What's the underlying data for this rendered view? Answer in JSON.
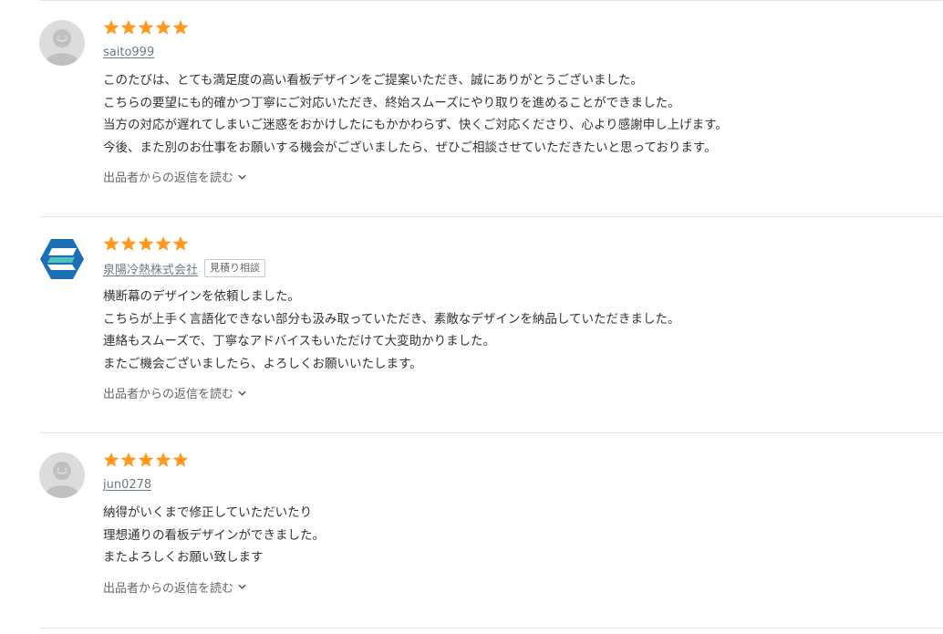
{
  "colors": {
    "star": "#ff9a1f",
    "username": "#6d7a80",
    "divider": "#e5e5e5",
    "text": "#333333",
    "logo_blue": "#1a6fb5",
    "logo_teal": "#4fc3b9"
  },
  "reviews": [
    {
      "rating": 5,
      "avatar": "default-avatar",
      "username": "saito999",
      "tag": "",
      "comment_lines": [
        "このたびは、とても満足度の高い看板デザインをご提案いただき、誠にありがとうございました。",
        "こちらの要望にも的確かつ丁寧にご対応いただき、終始スムーズにやり取りを進めることができました。",
        "当方の対応が遅れてしまいご迷惑をおかけしたにもかかわらず、快くご対応くださり、心より感謝申し上げます。",
        "今後、また別のお仕事をお願いする機会がございましたら、ぜひご相談させていただきたいと思っております。"
      ],
      "reply_label": "出品者からの返信を読む"
    },
    {
      "rating": 5,
      "avatar": "company-logo",
      "username": "泉陽冷熱株式会社",
      "tag": "見積り相談",
      "comment_lines": [
        "横断幕のデザインを依頼しました。",
        "こちらが上手く言語化できない部分も汲み取っていただき、素敵なデザインを納品していただきました。",
        "連絡もスムーズで、丁寧なアドバイスもいただけて大変助かりました。",
        "またご機会ございましたら、よろしくお願いいたします。"
      ],
      "reply_label": "出品者からの返信を読む"
    },
    {
      "rating": 5,
      "avatar": "default-avatar",
      "username": "jun0278",
      "tag": "",
      "comment_lines": [
        "納得がいくまで修正していただいたり",
        "理想通りの看板デザインができました。",
        "またよろしくお願い致します"
      ],
      "reply_label": "出品者からの返信を読む"
    }
  ]
}
